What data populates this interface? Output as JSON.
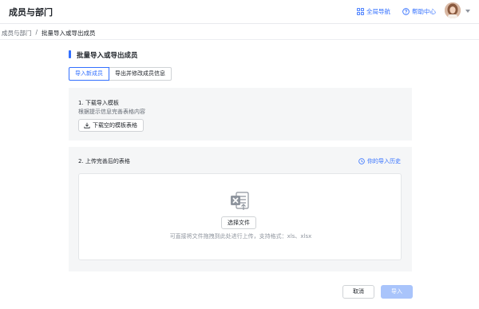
{
  "header": {
    "title": "成员与部门",
    "global_nav": "全局导航",
    "help_center": "帮助中心",
    "icons": [
      "grid-icon",
      "question-circle-icon",
      "avatar",
      "caret-down-icon"
    ]
  },
  "breadcrumb": {
    "parent": "成员与部门",
    "separator": "/",
    "current": "批量导入或导出成员"
  },
  "section": {
    "title": "批量导入或导出成员",
    "tabs": [
      {
        "label": "导入新成员",
        "active": true
      },
      {
        "label": "导出并修改成员信息",
        "active": false
      }
    ]
  },
  "download": {
    "step": "1. 下载导入模板",
    "description": "根据提示信息完善表格内容",
    "button": "下载空的模板表格"
  },
  "upload": {
    "step": "2. 上传完善后的表格",
    "history_link": "你的导入历史",
    "choose_button": "选择文件",
    "hint": "可直接将文件拖拽到此处进行上传，支持格式：xls、xlsx"
  },
  "footer": {
    "cancel": "取消",
    "import": "导入"
  },
  "colors": {
    "accent": "#3370ff",
    "disabled_primary": "#a9c4fb",
    "panel_bg": "#f5f6f7"
  }
}
